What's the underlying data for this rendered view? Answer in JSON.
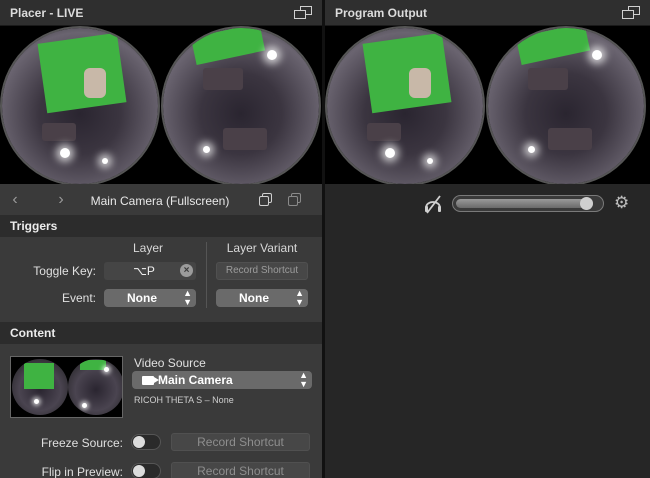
{
  "left_pane": {
    "title": "Placer - LIVE"
  },
  "right_pane": {
    "title": "Program Output"
  },
  "nav": {
    "prev_glyph": "‹",
    "next_glyph": "›",
    "layer_name": "Main Camera (Fullscreen)"
  },
  "triggers": {
    "section_title": "Triggers",
    "col_layer": "Layer",
    "col_variant": "Layer Variant",
    "toggle_key_label": "Toggle Key:",
    "toggle_key_value": "⌥P",
    "clear_glyph": "×",
    "variant_shortcut": "Record Shortcut",
    "event_label": "Event:",
    "event_value": "None",
    "variant_event_value": "None"
  },
  "content": {
    "section_title": "Content",
    "video_source_label": "Video Source",
    "video_source_value": "Main Camera",
    "device_info": "RICOH THETA S – None",
    "freeze_label": "Freeze Source:",
    "freeze_shortcut": "Record Shortcut",
    "flip_label": "Flip in Preview:",
    "flip_shortcut": "Record Shortcut"
  },
  "toggles": {
    "freeze_on": false,
    "flip_on": false
  },
  "audio": {
    "level_fraction": 0.95
  },
  "icons": {
    "settings": "⚙",
    "chevron_up": "▲",
    "chevron_down": "▼"
  },
  "colors": {
    "green_screen": "#3fb342",
    "panel_bg": "#3a3a3a",
    "section_bg": "#2c2c2c"
  }
}
